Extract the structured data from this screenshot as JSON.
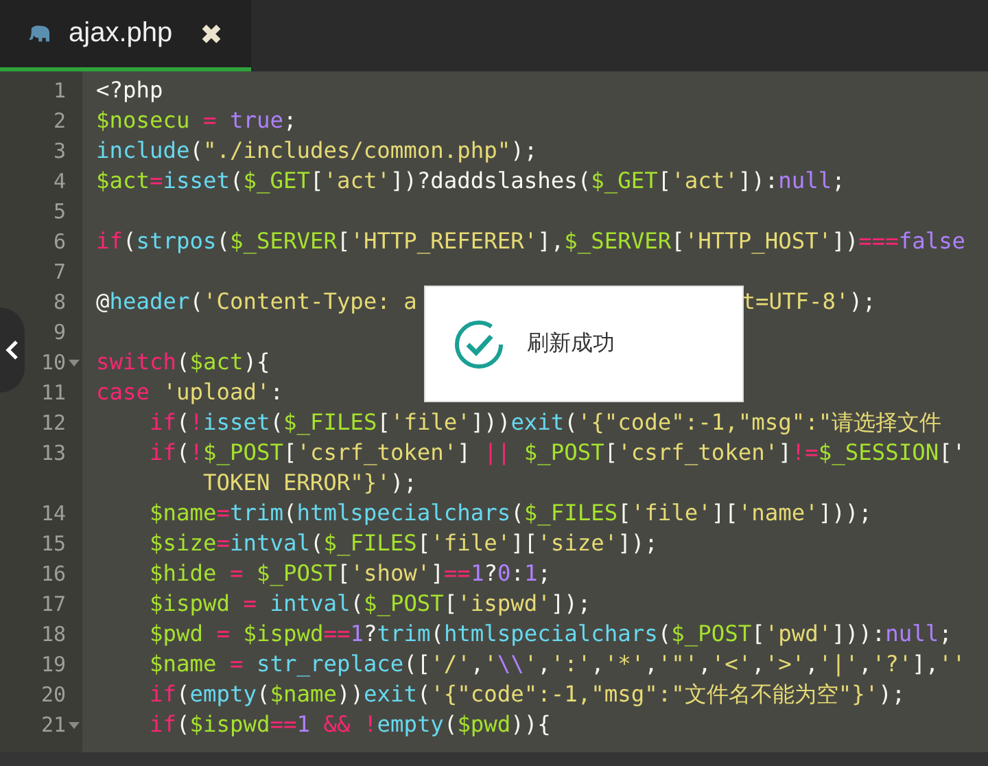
{
  "tabs": [
    {
      "label": "ajax.php",
      "close": "✖",
      "selected": true
    }
  ],
  "toast": {
    "message": "刷新成功"
  },
  "lines": [
    {
      "number": "1",
      "tokens": [
        {
          "kind": "plain",
          "text": "<?php"
        }
      ]
    },
    {
      "number": "2",
      "tokens": [
        {
          "kind": "var",
          "text": "$nosecu"
        },
        {
          "kind": "op",
          "text": " = "
        },
        {
          "kind": "const",
          "text": "true"
        },
        {
          "kind": "plain",
          "text": ";"
        }
      ]
    },
    {
      "number": "3",
      "tokens": [
        {
          "kind": "func",
          "text": "include"
        },
        {
          "kind": "plain",
          "text": "("
        },
        {
          "kind": "string",
          "text": "\"./includes/common.php\""
        },
        {
          "kind": "plain",
          "text": ");"
        }
      ]
    },
    {
      "number": "4",
      "tokens": [
        {
          "kind": "var",
          "text": "$act"
        },
        {
          "kind": "op",
          "text": "="
        },
        {
          "kind": "func",
          "text": "isset"
        },
        {
          "kind": "plain",
          "text": "("
        },
        {
          "kind": "var",
          "text": "$_GET"
        },
        {
          "kind": "plain",
          "text": "["
        },
        {
          "kind": "string",
          "text": "'act'"
        },
        {
          "kind": "plain",
          "text": "])?daddslashes("
        },
        {
          "kind": "var",
          "text": "$_GET"
        },
        {
          "kind": "plain",
          "text": "["
        },
        {
          "kind": "string",
          "text": "'act'"
        },
        {
          "kind": "plain",
          "text": "]):"
        },
        {
          "kind": "const",
          "text": "null"
        },
        {
          "kind": "plain",
          "text": ";"
        }
      ]
    },
    {
      "number": "5"
    },
    {
      "number": "6",
      "tokens": [
        {
          "kind": "keyword",
          "text": "if"
        },
        {
          "kind": "plain",
          "text": "("
        },
        {
          "kind": "func",
          "text": "strpos"
        },
        {
          "kind": "plain",
          "text": "("
        },
        {
          "kind": "var",
          "text": "$_SERVER"
        },
        {
          "kind": "plain",
          "text": "["
        },
        {
          "kind": "string",
          "text": "'HTTP_REFERER'"
        },
        {
          "kind": "plain",
          "text": "],"
        },
        {
          "kind": "var",
          "text": "$_SERVER"
        },
        {
          "kind": "plain",
          "text": "["
        },
        {
          "kind": "string",
          "text": "'HTTP_HOST'"
        },
        {
          "kind": "plain",
          "text": "])"
        },
        {
          "kind": "op",
          "text": "==="
        },
        {
          "kind": "const",
          "text": "false"
        }
      ]
    },
    {
      "number": "7"
    },
    {
      "number": "8",
      "tokens": [
        {
          "kind": "plain",
          "text": "@"
        },
        {
          "kind": "func",
          "text": "header"
        },
        {
          "kind": "plain",
          "text": "("
        },
        {
          "kind": "string",
          "text": "'Content-Type: a"
        },
        {
          "kind": "gap"
        },
        {
          "kind": "string",
          "text": "t=UTF-8'"
        },
        {
          "kind": "plain",
          "text": ");"
        }
      ]
    },
    {
      "number": "9"
    },
    {
      "number": "10",
      "fold": true,
      "tokens": [
        {
          "kind": "keyword",
          "text": "switch"
        },
        {
          "kind": "plain",
          "text": "("
        },
        {
          "kind": "var",
          "text": "$act"
        },
        {
          "kind": "plain",
          "text": "){"
        }
      ]
    },
    {
      "number": "11",
      "tokens": [
        {
          "kind": "keyword",
          "text": "case"
        },
        {
          "kind": "string",
          "text": " 'upload'"
        },
        {
          "kind": "plain",
          "text": ":"
        }
      ]
    },
    {
      "number": "12",
      "tokens": [
        {
          "kind": "keyword",
          "text": "    if"
        },
        {
          "kind": "plain",
          "text": "("
        },
        {
          "kind": "op",
          "text": "!"
        },
        {
          "kind": "func",
          "text": "isset"
        },
        {
          "kind": "plain",
          "text": "("
        },
        {
          "kind": "var",
          "text": "$_FILES"
        },
        {
          "kind": "plain",
          "text": "["
        },
        {
          "kind": "string",
          "text": "'file'"
        },
        {
          "kind": "plain",
          "text": "]))"
        },
        {
          "kind": "func",
          "text": "exit"
        },
        {
          "kind": "plain",
          "text": "("
        },
        {
          "kind": "string",
          "text": "'{\"code\":-1,\"msg\":\"请选择文件"
        }
      ]
    },
    {
      "number": "13",
      "tokens": [
        {
          "kind": "keyword",
          "text": "    if"
        },
        {
          "kind": "plain",
          "text": "("
        },
        {
          "kind": "op",
          "text": "!"
        },
        {
          "kind": "var",
          "text": "$_POST"
        },
        {
          "kind": "plain",
          "text": "["
        },
        {
          "kind": "string",
          "text": "'csrf_token'"
        },
        {
          "kind": "plain",
          "text": "] "
        },
        {
          "kind": "op",
          "text": "|| "
        },
        {
          "kind": "var",
          "text": "$_POST"
        },
        {
          "kind": "plain",
          "text": "["
        },
        {
          "kind": "string",
          "text": "'csrf_token'"
        },
        {
          "kind": "plain",
          "text": "]"
        },
        {
          "kind": "op",
          "text": "!="
        },
        {
          "kind": "var",
          "text": "$_SESSION"
        },
        {
          "kind": "plain",
          "text": "['"
        }
      ],
      "wrap": [
        {
          "kind": "string",
          "text": "        TOKEN ERROR\"}'"
        },
        {
          "kind": "plain",
          "text": ");"
        }
      ]
    },
    {
      "number": "14",
      "tokens": [
        {
          "kind": "var",
          "text": "    $name"
        },
        {
          "kind": "op",
          "text": "="
        },
        {
          "kind": "func",
          "text": "trim"
        },
        {
          "kind": "plain",
          "text": "("
        },
        {
          "kind": "func",
          "text": "htmlspecialchars"
        },
        {
          "kind": "plain",
          "text": "("
        },
        {
          "kind": "var",
          "text": "$_FILES"
        },
        {
          "kind": "plain",
          "text": "["
        },
        {
          "kind": "string",
          "text": "'file'"
        },
        {
          "kind": "plain",
          "text": "]["
        },
        {
          "kind": "string",
          "text": "'name'"
        },
        {
          "kind": "plain",
          "text": "]));"
        }
      ]
    },
    {
      "number": "15",
      "tokens": [
        {
          "kind": "var",
          "text": "    $size"
        },
        {
          "kind": "op",
          "text": "="
        },
        {
          "kind": "func",
          "text": "intval"
        },
        {
          "kind": "plain",
          "text": "("
        },
        {
          "kind": "var",
          "text": "$_FILES"
        },
        {
          "kind": "plain",
          "text": "["
        },
        {
          "kind": "string",
          "text": "'file'"
        },
        {
          "kind": "plain",
          "text": "]["
        },
        {
          "kind": "string",
          "text": "'size'"
        },
        {
          "kind": "plain",
          "text": "]);"
        }
      ]
    },
    {
      "number": "16",
      "tokens": [
        {
          "kind": "var",
          "text": "    $hide"
        },
        {
          "kind": "op",
          "text": " = "
        },
        {
          "kind": "var",
          "text": "$_POST"
        },
        {
          "kind": "plain",
          "text": "["
        },
        {
          "kind": "string",
          "text": "'show'"
        },
        {
          "kind": "plain",
          "text": "]"
        },
        {
          "kind": "op",
          "text": "=="
        },
        {
          "kind": "const",
          "text": "1"
        },
        {
          "kind": "plain",
          "text": "?"
        },
        {
          "kind": "const",
          "text": "0"
        },
        {
          "kind": "plain",
          "text": ":"
        },
        {
          "kind": "const",
          "text": "1"
        },
        {
          "kind": "plain",
          "text": ";"
        }
      ]
    },
    {
      "number": "17",
      "tokens": [
        {
          "kind": "var",
          "text": "    $ispwd"
        },
        {
          "kind": "op",
          "text": " = "
        },
        {
          "kind": "func",
          "text": "intval"
        },
        {
          "kind": "plain",
          "text": "("
        },
        {
          "kind": "var",
          "text": "$_POST"
        },
        {
          "kind": "plain",
          "text": "["
        },
        {
          "kind": "string",
          "text": "'ispwd'"
        },
        {
          "kind": "plain",
          "text": "]);"
        }
      ]
    },
    {
      "number": "18",
      "tokens": [
        {
          "kind": "var",
          "text": "    $pwd"
        },
        {
          "kind": "op",
          "text": " = "
        },
        {
          "kind": "var",
          "text": "$ispwd"
        },
        {
          "kind": "op",
          "text": "=="
        },
        {
          "kind": "const",
          "text": "1"
        },
        {
          "kind": "plain",
          "text": "?"
        },
        {
          "kind": "func",
          "text": "trim"
        },
        {
          "kind": "plain",
          "text": "("
        },
        {
          "kind": "func",
          "text": "htmlspecialchars"
        },
        {
          "kind": "plain",
          "text": "("
        },
        {
          "kind": "var",
          "text": "$_POST"
        },
        {
          "kind": "plain",
          "text": "["
        },
        {
          "kind": "string",
          "text": "'pwd'"
        },
        {
          "kind": "plain",
          "text": "])):"
        },
        {
          "kind": "const",
          "text": "null"
        },
        {
          "kind": "plain",
          "text": ";"
        }
      ]
    },
    {
      "number": "19",
      "tokens": [
        {
          "kind": "var",
          "text": "    $name"
        },
        {
          "kind": "op",
          "text": " = "
        },
        {
          "kind": "func",
          "text": "str_replace"
        },
        {
          "kind": "plain",
          "text": "(["
        },
        {
          "kind": "string",
          "text": "'/'"
        },
        {
          "kind": "plain",
          "text": ","
        },
        {
          "kind": "string",
          "text": "'"
        },
        {
          "kind": "const",
          "text": "\\\\"
        },
        {
          "kind": "string",
          "text": "'"
        },
        {
          "kind": "plain",
          "text": ","
        },
        {
          "kind": "string",
          "text": "':'"
        },
        {
          "kind": "plain",
          "text": ","
        },
        {
          "kind": "string",
          "text": "'*'"
        },
        {
          "kind": "plain",
          "text": ","
        },
        {
          "kind": "string",
          "text": "'\"'"
        },
        {
          "kind": "plain",
          "text": ","
        },
        {
          "kind": "string",
          "text": "'<'"
        },
        {
          "kind": "plain",
          "text": ","
        },
        {
          "kind": "string",
          "text": "'>'"
        },
        {
          "kind": "plain",
          "text": ","
        },
        {
          "kind": "string",
          "text": "'|'"
        },
        {
          "kind": "plain",
          "text": ","
        },
        {
          "kind": "string",
          "text": "'?'"
        },
        {
          "kind": "plain",
          "text": "],"
        },
        {
          "kind": "string",
          "text": "''"
        }
      ]
    },
    {
      "number": "20",
      "tokens": [
        {
          "kind": "keyword",
          "text": "    if"
        },
        {
          "kind": "plain",
          "text": "("
        },
        {
          "kind": "func",
          "text": "empty"
        },
        {
          "kind": "plain",
          "text": "("
        },
        {
          "kind": "var",
          "text": "$name"
        },
        {
          "kind": "plain",
          "text": "))"
        },
        {
          "kind": "func",
          "text": "exit"
        },
        {
          "kind": "plain",
          "text": "("
        },
        {
          "kind": "string",
          "text": "'{\"code\":-1,\"msg\":\"文件名不能为空\"}'"
        },
        {
          "kind": "plain",
          "text": ");"
        }
      ]
    },
    {
      "number": "21",
      "fold": true,
      "tokens": [
        {
          "kind": "keyword",
          "text": "    if"
        },
        {
          "kind": "plain",
          "text": "("
        },
        {
          "kind": "var",
          "text": "$ispwd"
        },
        {
          "kind": "op",
          "text": "=="
        },
        {
          "kind": "const",
          "text": "1"
        },
        {
          "kind": "op",
          "text": " && !"
        },
        {
          "kind": "func",
          "text": "empty"
        },
        {
          "kind": "plain",
          "text": "("
        },
        {
          "kind": "var",
          "text": "$pwd"
        },
        {
          "kind": "plain",
          "text": ")){"
        }
      ]
    }
  ]
}
